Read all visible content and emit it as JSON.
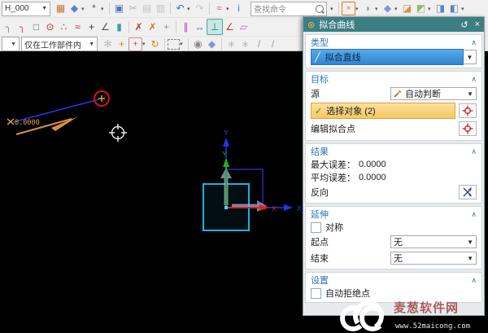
{
  "toolbar": {
    "part_dropdown": "H_000",
    "search_placeholder": "查找命令",
    "scope_dropdown": "仅在工作部件内",
    "row1_left": [
      {
        "name": "sketch",
        "glyph": "▦",
        "color": "#c9763a"
      },
      {
        "name": "datum-cube",
        "glyph": "◆",
        "color": "#5b82c9",
        "dd": true
      },
      {
        "name": "more-tools",
        "glyph": "*",
        "color": "#555",
        "dd": true
      },
      {
        "type": "sep"
      },
      {
        "name": "save",
        "glyph": "▣",
        "color": "#5577bb"
      },
      {
        "name": "cut",
        "glyph": "✂",
        "color": "#b5b5b5"
      },
      {
        "name": "copy",
        "glyph": "▤",
        "color": "#c2c2c2"
      },
      {
        "name": "paste",
        "glyph": "▥",
        "color": "#c2c2c2"
      },
      {
        "type": "sep"
      },
      {
        "name": "undo",
        "glyph": "↶",
        "color": "#3a6fd0",
        "dd": true
      },
      {
        "name": "redo",
        "glyph": "↷",
        "color": "#c2c2c2"
      },
      {
        "type": "sep"
      },
      {
        "name": "sketch-curve",
        "glyph": "≈",
        "color": "#cc6666",
        "dd": true
      },
      {
        "name": "info",
        "glyph": "i",
        "color": "#3a6fd0"
      }
    ],
    "row1_right": [
      {
        "name": "fit-view",
        "glyph": "×",
        "color": "#e07820",
        "border": "#e07820",
        "dd": true
      },
      {
        "name": "render-style",
        "glyph": "◗",
        "color": "#9a9a9a",
        "dd": true
      },
      {
        "name": "view-orient-cube",
        "glyph": "◆",
        "color": "#7a9ad8",
        "dd": true
      },
      {
        "name": "datum-plane",
        "glyph": "◪",
        "color": "#d89040"
      },
      {
        "name": "plane-normal",
        "glyph": "◩",
        "color": "#88bb66",
        "dd": true
      },
      {
        "name": "extrude",
        "glyph": "◨",
        "color": "#5b82c9"
      },
      {
        "name": "revolve",
        "glyph": "◧",
        "color": "#5b82c9",
        "dd": true
      }
    ],
    "row2": [
      {
        "name": "fillet",
        "glyph": "╮",
        "color": "#8a8a8a"
      },
      {
        "name": "chamfer",
        "glyph": "╮",
        "color": "#b05050"
      },
      {
        "name": "rectangle-tool",
        "glyph": "□",
        "color": "#666"
      },
      {
        "name": "polygon-tool",
        "glyph": "⊙",
        "color": "#aa3333"
      },
      {
        "name": "spline-points",
        "glyph": "∴",
        "color": "#aa3333"
      },
      {
        "name": "studio-spline",
        "glyph": "≈",
        "color": "#aa3333"
      },
      {
        "name": "point-tool",
        "glyph": "+",
        "color": "#333"
      },
      {
        "name": "trim-recipe",
        "glyph": "∠",
        "color": "#556"
      },
      {
        "name": "offset-curve",
        "glyph": "▮",
        "color": "#3aa0a0"
      },
      {
        "type": "sep"
      },
      {
        "name": "quick-trim",
        "glyph": "✗",
        "color": "#cc3333"
      },
      {
        "name": "quick-extend",
        "glyph": "✗",
        "color": "#dd7700"
      },
      {
        "name": "make-corner",
        "glyph": "+",
        "color": "#999"
      },
      {
        "type": "sep"
      },
      {
        "name": "geometric-constraints",
        "glyph": "∥",
        "color": "#9944bb"
      },
      {
        "name": "rapid-dimension",
        "glyph": "↔",
        "color": "#446688"
      },
      {
        "name": "fit-curve-active",
        "glyph": "⊥",
        "color": "#0d8877",
        "active": true
      },
      {
        "name": "constraint-angle",
        "glyph": "∠",
        "color": "#bb4444"
      },
      {
        "name": "constraint-parallelogram",
        "glyph": "▱",
        "color": "#bb66bb"
      }
    ],
    "row3": [
      {
        "name": "snap-settings",
        "glyph": "✻",
        "color": "#bdbdbd"
      },
      {
        "name": "snap-point",
        "glyph": "+",
        "color": "#dd8800"
      },
      {
        "name": "snap-point-enable",
        "glyph": "+",
        "color": "#cc4444",
        "border": "#cc8888",
        "dd": true
      },
      {
        "name": "rotate-point",
        "glyph": "↻",
        "color": "#dd8800"
      },
      {
        "type": "sep"
      },
      {
        "name": "selection-rectangle",
        "glyph": "",
        "color": "#777",
        "dashed": true,
        "dd": true
      },
      {
        "type": "sep"
      },
      {
        "name": "show-hide",
        "glyph": "◉",
        "color": "#8a8a8a"
      },
      {
        "name": "work-layer-cube",
        "glyph": "◆",
        "color": "#7a9ad8"
      },
      {
        "type": "sep"
      },
      {
        "name": "move-object",
        "glyph": "∗",
        "color": "#bdbdbd"
      },
      {
        "name": "pattern-object",
        "glyph": "∗",
        "color": "#bdbdbd"
      },
      {
        "name": "line-tool-a",
        "glyph": "/",
        "color": "#9a9a9a"
      },
      {
        "name": "line-tool-b",
        "glyph": "/",
        "color": "#9a9a9a"
      }
    ]
  },
  "dialog": {
    "title": "拟合曲线",
    "reset_icon": "↺",
    "close_icon": "×",
    "type": {
      "header": "类型",
      "value": "拟合直线"
    },
    "target": {
      "header": "目标",
      "source_label": "源",
      "source_value": "自动判断",
      "select_object_label": "选择对象 (2)",
      "edit_fit_points_label": "编辑拟合点"
    },
    "result": {
      "header": "结果",
      "max_error_label": "最大误差：",
      "max_error_value": "0.0000",
      "avg_error_label": "平均误差：",
      "avg_error_value": "0.0000",
      "reverse_label": "反向"
    },
    "extension": {
      "header": "延伸",
      "symmetric_label": "对称",
      "start_label": "起点",
      "start_value": "无",
      "end_label": "结束",
      "end_value": "无"
    },
    "settings": {
      "header": "设置",
      "auto_reject_label": "自动拒绝点"
    }
  },
  "viewport": {
    "distance_label": "0.0000",
    "axis": {
      "x": "X",
      "y": "Y",
      "sketch_x": "X",
      "sketch_y": "Y"
    }
  },
  "watermark": {
    "title": "麦葱软件网",
    "url": "www.52maicong.com"
  },
  "colors": {
    "dialog_titlebar": "#3c7e84",
    "section_header": "#2e75b6",
    "type_selected": "#3a91e0",
    "select_object_bg": "#f6c964",
    "fit_line": "#2233ee",
    "endpoint_circle": "#dd1111",
    "direction_arrow": "#d89040",
    "highlight_square": "#1ab0e8"
  }
}
